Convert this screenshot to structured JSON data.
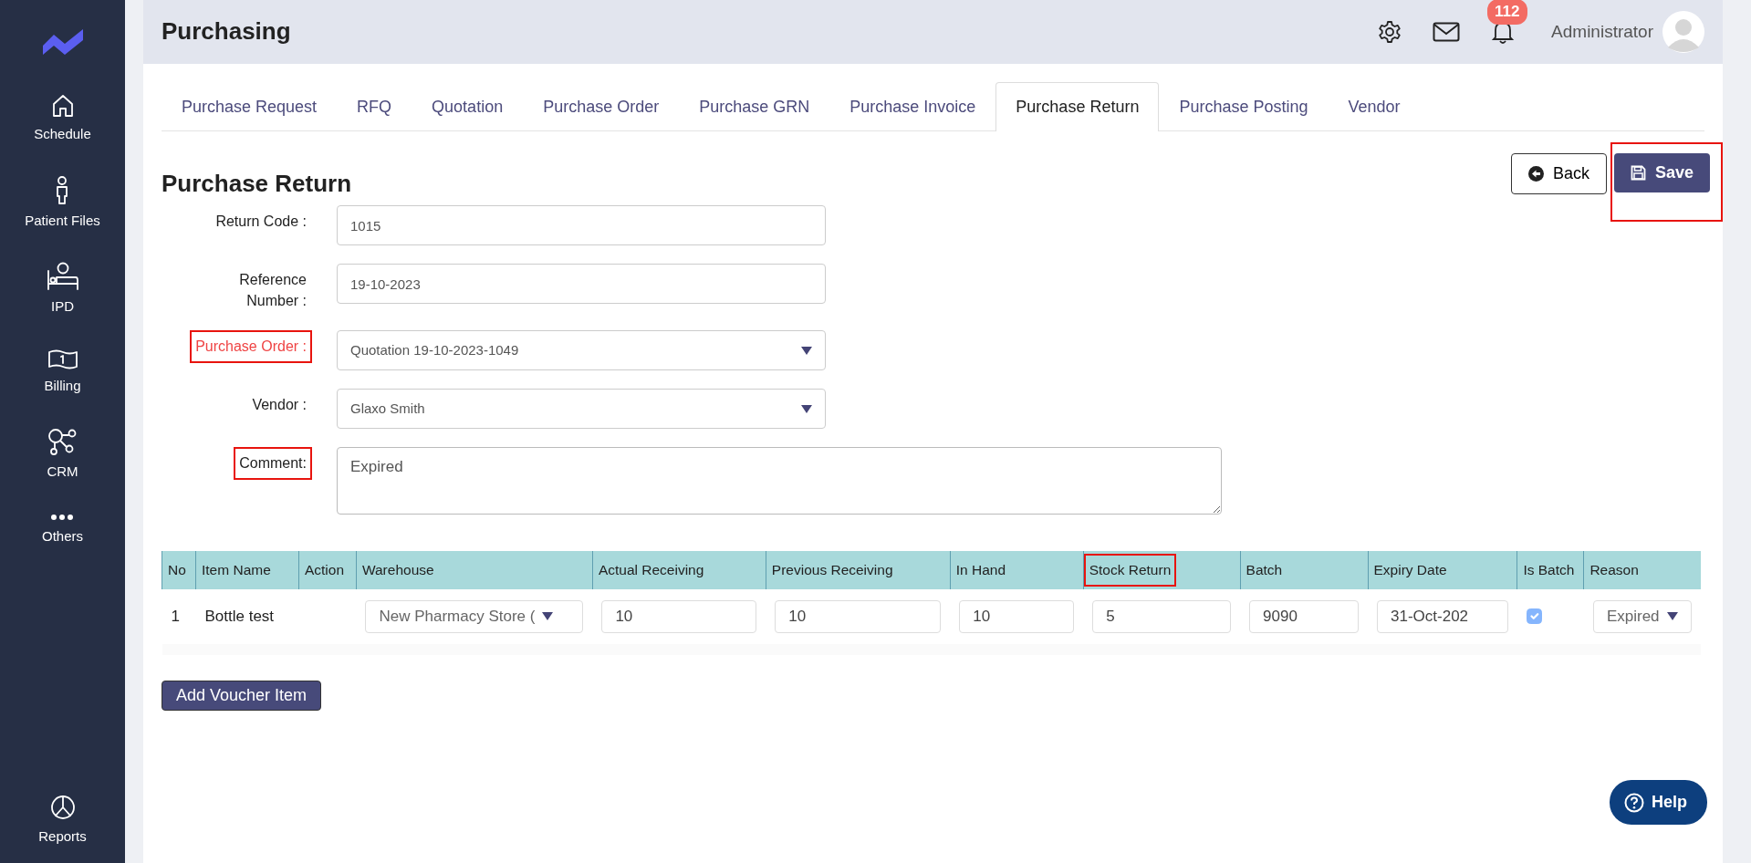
{
  "sidebar": {
    "items": [
      {
        "label": "Schedule",
        "kind": "home"
      },
      {
        "label": "Patient Files",
        "kind": "person"
      },
      {
        "label": "IPD",
        "kind": "bed"
      },
      {
        "label": "Billing",
        "kind": "money"
      },
      {
        "label": "CRM",
        "kind": "nodes"
      },
      {
        "label": "Others",
        "kind": "dots"
      }
    ],
    "footer": {
      "label": "Reports",
      "kind": "pie"
    }
  },
  "header": {
    "title": "Purchasing",
    "notification_count": "112",
    "user": "Administrator"
  },
  "tabs": [
    {
      "label": "Purchase Request",
      "selected": false
    },
    {
      "label": "RFQ",
      "selected": false
    },
    {
      "label": "Quotation",
      "selected": false
    },
    {
      "label": "Purchase Order",
      "selected": false
    },
    {
      "label": "Purchase GRN",
      "selected": false
    },
    {
      "label": "Purchase Invoice",
      "selected": false
    },
    {
      "label": "Purchase Return",
      "selected": true
    },
    {
      "label": "Purchase Posting",
      "selected": false
    },
    {
      "label": "Vendor",
      "selected": false
    }
  ],
  "page": {
    "title": "Purchase Return",
    "buttons": [
      {
        "kind": "back",
        "label": "Back"
      },
      {
        "kind": "save",
        "label": "Save",
        "highlighted": true
      }
    ]
  },
  "form": {
    "fields": [
      {
        "label": "Return Code :",
        "kind": "text",
        "value": "1015",
        "invalid": false
      },
      {
        "label": "Reference Number :",
        "kind": "text",
        "value": "19-10-2023",
        "invalid": false
      },
      {
        "label": "Purchase Order :",
        "kind": "select",
        "value": "Quotation 19-10-2023-1049",
        "invalid": true,
        "highlighted": true
      },
      {
        "label": "Vendor :",
        "kind": "select",
        "value": "Glaxo Smith",
        "invalid": false
      },
      {
        "label": "Comment:",
        "kind": "textarea",
        "value": "Expired",
        "invalid": false,
        "highlighted": true
      }
    ]
  },
  "table": {
    "columns": [
      {
        "label": "No"
      },
      {
        "label": "Item Name"
      },
      {
        "label": "Action"
      },
      {
        "label": "Warehouse"
      },
      {
        "label": "Actual Receiving"
      },
      {
        "label": "Previous Receiving"
      },
      {
        "label": "In Hand"
      },
      {
        "label": "Stock Return",
        "highlighted": true
      },
      {
        "label": "Batch"
      },
      {
        "label": "Expiry Date"
      },
      {
        "label": "Is Batch"
      },
      {
        "label": "Reason"
      }
    ],
    "rows": [
      {
        "no": "1",
        "item_name": "Bottle test",
        "warehouse": "New Pharmacy Store (",
        "actual_receiving": "10",
        "previous_receiving": "10",
        "in_hand": "10",
        "stock_return": "5",
        "batch": "9090",
        "expiry_date": "31-Oct-202",
        "is_batch": {
          "checked": true,
          "disabled": true
        },
        "reason": "Expired"
      }
    ]
  },
  "add_button": "Add Voucher Item",
  "help_button": "Help"
}
